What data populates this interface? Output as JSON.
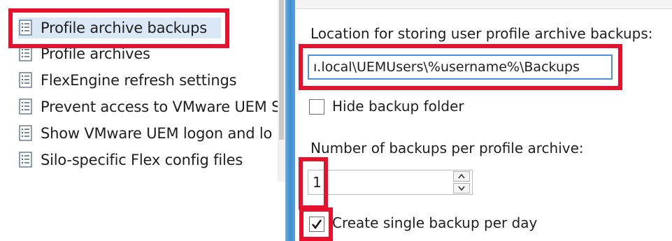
{
  "tree": {
    "items": [
      {
        "label": "Profile archive backups",
        "selected": true
      },
      {
        "label": "Profile archives",
        "selected": false
      },
      {
        "label": "FlexEngine refresh settings",
        "selected": false
      },
      {
        "label": "Prevent access to VMware UEM S",
        "selected": false
      },
      {
        "label": "Show VMware UEM logon and lo",
        "selected": false
      },
      {
        "label": "Silo-specific Flex config files",
        "selected": false
      }
    ],
    "icon": "policy-document-icon"
  },
  "settings": {
    "location_label": "Location for storing user profile archive backups:",
    "location_value": "ı.local\\UEMUsers\\%username%\\Backups",
    "hide_backup_folder": {
      "label": "Hide backup folder",
      "checked": false
    },
    "backups_count_label": "Number of backups per profile archive:",
    "backups_count_value": "1",
    "single_backup_per_day": {
      "label": "Create single backup per day",
      "checked": true
    }
  },
  "colors": {
    "highlight": "#e8112d",
    "selection": "#d9e7f6",
    "splitter": "#3f8fd0",
    "focus_border": "#4a90d9"
  }
}
